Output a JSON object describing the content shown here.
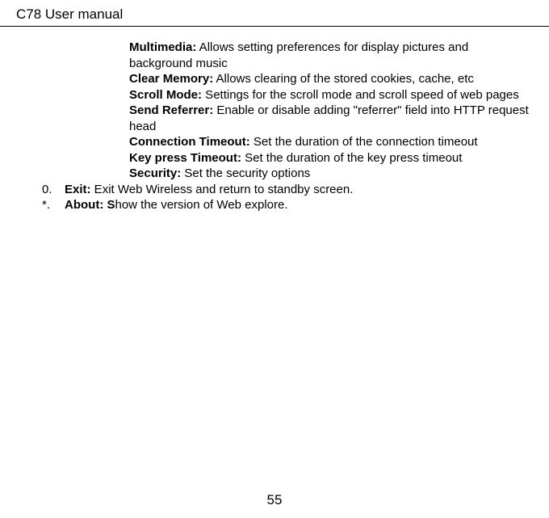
{
  "header": {
    "title": "C78 User manual"
  },
  "settings": {
    "multimedia": {
      "label": "Multimedia:",
      "desc": "   Allows setting preferences for display pictures and background music"
    },
    "clearMemory": {
      "label": "Clear Memory:",
      "desc": "  Allows clearing of the stored cookies, cache, etc"
    },
    "scrollMode": {
      "label": "Scroll Mode:",
      "desc": "  Settings for the scroll mode and scroll speed of web pages"
    },
    "sendReferrer": {
      "label": "Send Referrer:",
      "desc": "  Enable or disable adding \"referrer\" field into HTTP request head"
    },
    "connectionTimeout": {
      "label": "Connection Timeout:",
      "desc": "  Set the duration of the connection timeout"
    },
    "keyPressTimeout": {
      "label": "Key press Timeout:",
      "desc": "  Set the duration of the key press timeout"
    },
    "security": {
      "label": "Security:",
      "desc": "  Set the security options"
    }
  },
  "items": {
    "exit": {
      "marker": "0.",
      "label": "Exit:",
      "desc": "  Exit Web Wireless and return to standby screen."
    },
    "about": {
      "marker": "*.",
      "label": "About:  S",
      "desc": "how the version of Web explore."
    }
  },
  "pageNumber": "55"
}
